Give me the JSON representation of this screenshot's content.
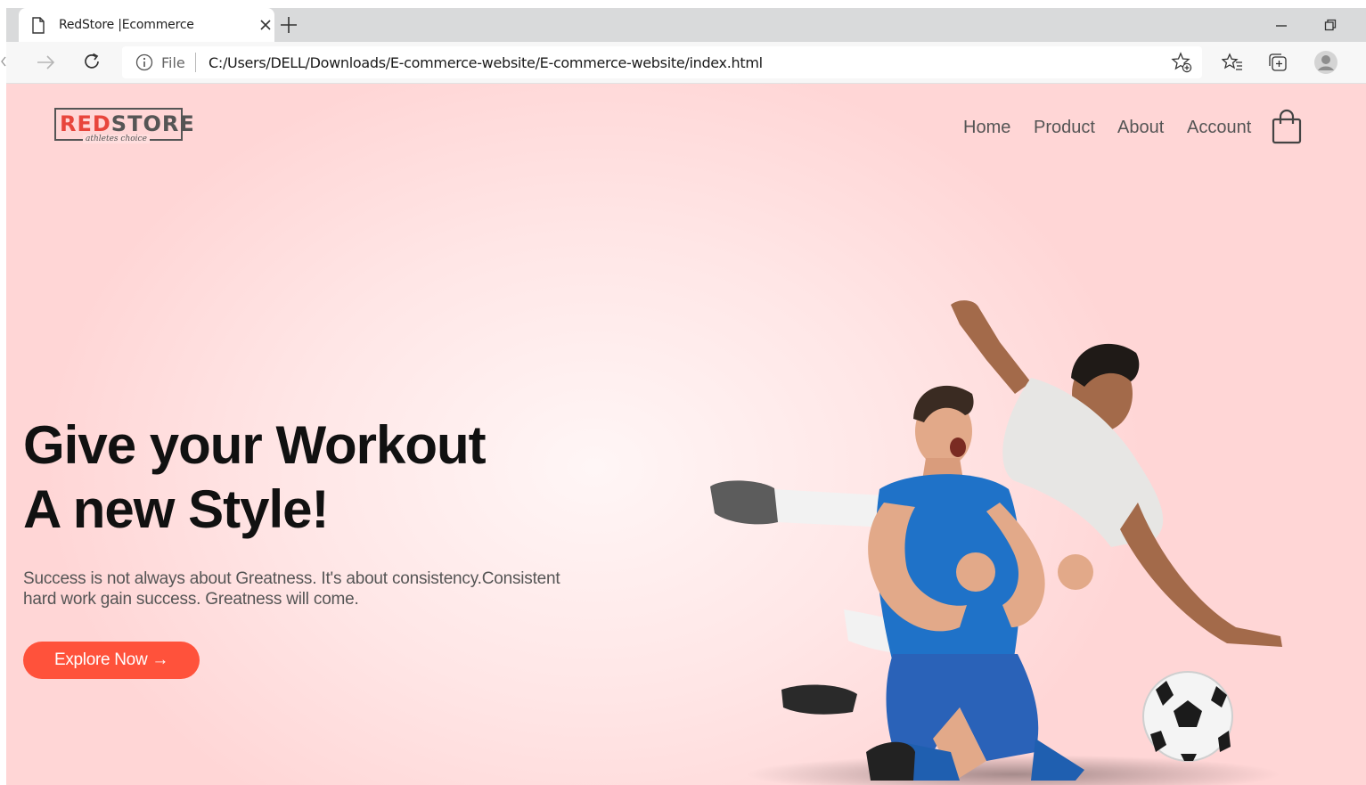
{
  "browser": {
    "tab_title": "RedStore |Ecommerce",
    "address_scheme_label": "File",
    "address_url": "C:/Users/DELL/Downloads/E-commerce-website/E-commerce-website/index.html",
    "icons": [
      "page-icon",
      "close-icon",
      "plus-icon",
      "minimize-icon",
      "restore-icon",
      "back-icon",
      "forward-icon",
      "reload-icon",
      "info-icon",
      "add-favorite-icon",
      "favorites-icon",
      "collections-icon",
      "profile-icon"
    ]
  },
  "site": {
    "logo": {
      "red": "RED",
      "dark": "STORE",
      "tagline": "athletes choice"
    },
    "nav": [
      "Home",
      "Product",
      "About",
      "Account"
    ],
    "cart_icon": "shopping-bag-icon",
    "hero": {
      "headline_line1": "Give your Workout",
      "headline_line2": "A new Style!",
      "text": "Success is not always about Greatness. It's about consistency.Consistent hard work gain success. Greatness will come.",
      "button_label": "Explore Now →"
    }
  },
  "colors": {
    "accent": "#ff523b",
    "page_background": "#ffd6d6",
    "tab_strip": "#d9dadb",
    "toolbar": "#f7f7f7"
  }
}
